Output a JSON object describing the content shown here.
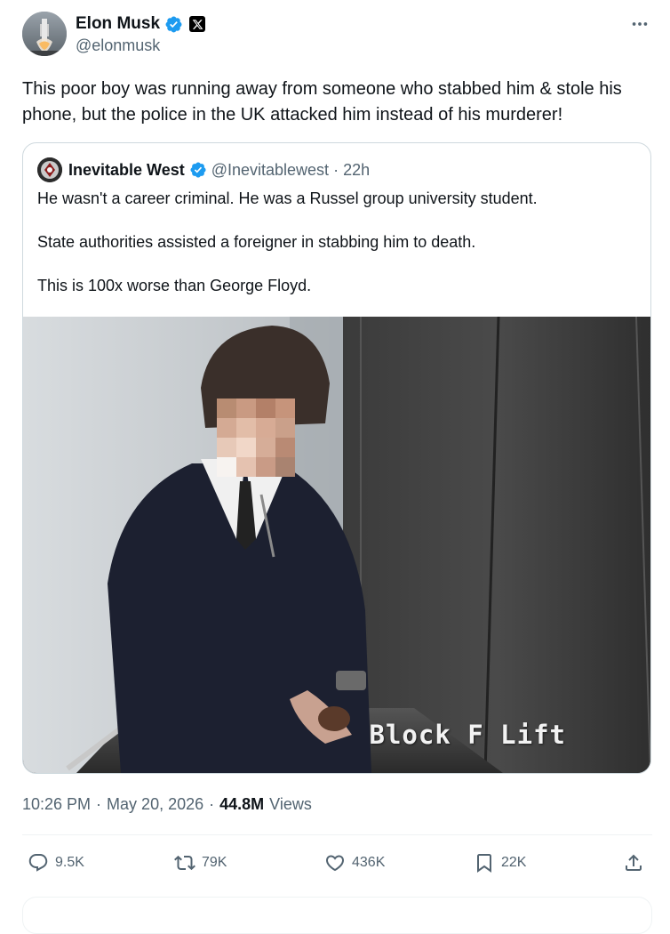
{
  "author": {
    "name": "Elon Musk",
    "handle": "@elonmusk",
    "verified_color": "#1d9bf0",
    "badges": [
      "verified-icon",
      "x-logo-icon"
    ]
  },
  "post": {
    "text": "This poor boy was running away from someone who stabbed him & stole his phone, but the police in the UK attacked him instead of his murderer!",
    "more_icon": "more-horizontal-icon"
  },
  "quote": {
    "name": "Inevitable West",
    "handle": "@Inevitablewest",
    "separator": "·",
    "time": "22h",
    "paragraphs": [
      "He wasn't a career criminal. He was a Russel group university student.",
      "State authorities assisted a foreigner in stabbing him to death.",
      "This is 100x worse than George Floyd."
    ],
    "media_caption": "Block F Lift"
  },
  "meta": {
    "time": "10:26 PM",
    "separator": "·",
    "date": "May 20, 2026",
    "separator2": "·",
    "views_count": "44.8M",
    "views_label": "Views"
  },
  "actions": {
    "reply": {
      "icon": "reply-icon",
      "count": "9.5K"
    },
    "repost": {
      "icon": "repost-icon",
      "count": "79K"
    },
    "like": {
      "icon": "heart-icon",
      "count": "436K"
    },
    "bookmark": {
      "icon": "bookmark-icon",
      "count": "22K"
    },
    "share": {
      "icon": "share-icon"
    }
  },
  "colors": {
    "text_primary": "#0f1419",
    "text_secondary": "#536471",
    "accent": "#1d9bf0",
    "border": "#cfd9de"
  }
}
